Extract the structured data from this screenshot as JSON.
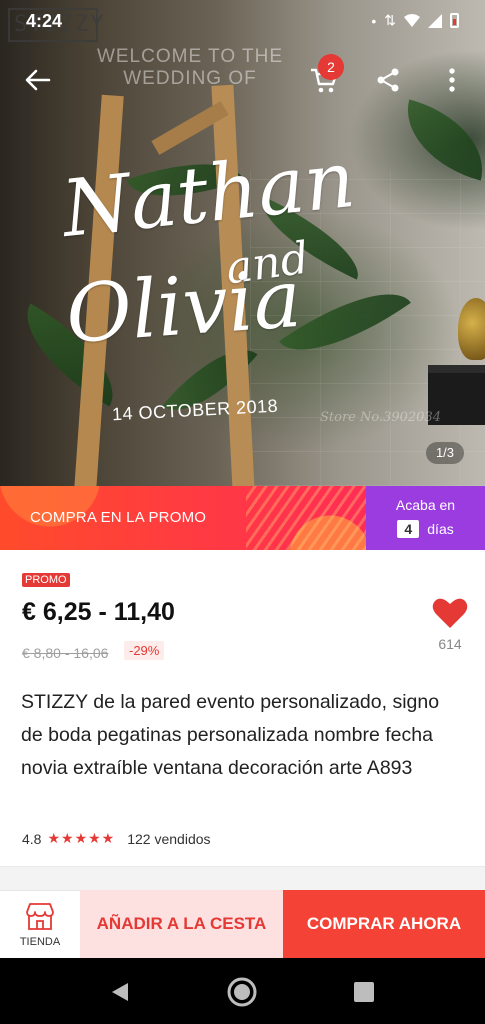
{
  "status_bar": {
    "time": "4:24",
    "icons": [
      "dot-icon",
      "data-arrows-icon",
      "wifi-icon",
      "signal-icon",
      "battery-icon"
    ]
  },
  "hero": {
    "logo_text": "STIZZY",
    "welcome_text": "WELCOME TO THE WEDDING OF",
    "script_line1": "Nathan",
    "script_and": "and",
    "script_line2": "Olivia",
    "date_text": "14 OCTOBER 2018",
    "watermark": "Store No.3902034",
    "pager": "1/3",
    "cart_count": "2"
  },
  "promo": {
    "label": "COMPRA EN LA PROMO",
    "ends_label": "Acaba en",
    "days": "4",
    "days_unit": "días"
  },
  "product": {
    "tag": "PROMO",
    "price": "€ 6,25 - 11,40",
    "old_price": "€ 8,80 - 16,06",
    "discount": "-29%",
    "wishlist_count": "614",
    "title": "STIZZY de la pared evento personalizado, signo de boda pegatinas personalizada nombre fecha novia extraíble ventana decoración arte A893",
    "rating": "4.8",
    "stars": "★★★★★",
    "sold": "122 vendidos"
  },
  "actions": {
    "store_label": "TIENDA",
    "add_to_cart": "AÑADIR A LA CESTA",
    "buy_now": "COMPRAR AHORA"
  },
  "colors": {
    "accent_red": "#e53935",
    "buy_button": "#f44336",
    "cart_button_bg": "#fde0e0",
    "promo_purple": "#9b3ce0"
  }
}
